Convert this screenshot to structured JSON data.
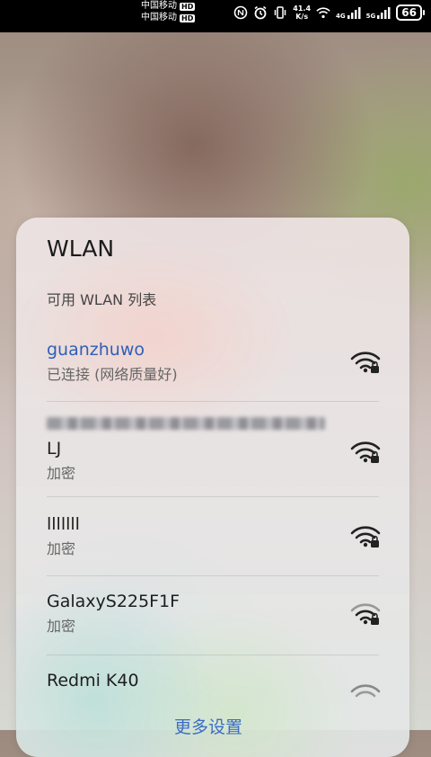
{
  "status_bar": {
    "carrier_1": "中国移动",
    "carrier_2": "中国移动",
    "hd_badge": "HD",
    "speed_value": "41.4",
    "speed_unit": "K/s",
    "net_1": "4G",
    "net_2": "5G",
    "battery": "66"
  },
  "wlan_panel": {
    "title": "WLAN",
    "section_label": "可用 WLAN 列表",
    "networks": [
      {
        "name": "guanzhuwo",
        "status": "已连接 (网络质量好)",
        "signal": "full",
        "locked": true
      },
      {
        "name": "LJ",
        "status": "加密",
        "signal": "full",
        "locked": true
      },
      {
        "name": "lllllll",
        "status": "加密",
        "signal": "full",
        "locked": true
      },
      {
        "name": "GalaxyS225F1F",
        "status": "加密",
        "signal": "medium",
        "locked": true
      },
      {
        "name": "Redmi K40",
        "status": "",
        "signal": "weak",
        "locked": true
      }
    ],
    "more_settings": "更多设置"
  },
  "colors": {
    "accent": "#2f5fb8",
    "link": "#3a6cc2"
  }
}
